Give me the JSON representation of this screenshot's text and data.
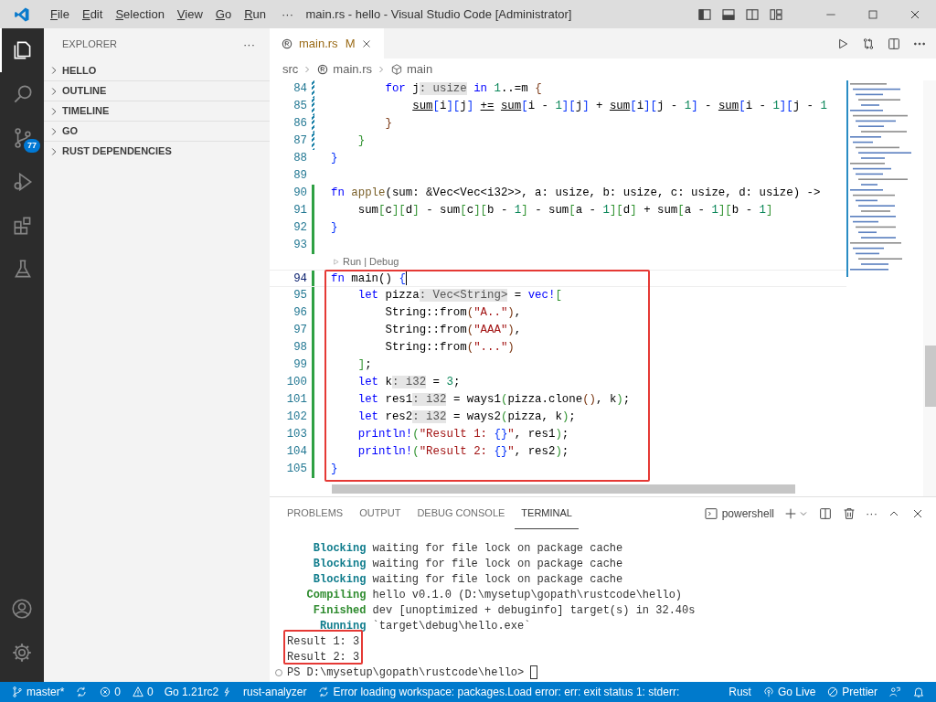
{
  "window": {
    "title": "main.rs - hello - Visual Studio Code [Administrator]"
  },
  "menu": [
    {
      "label": "File"
    },
    {
      "label": "Edit"
    },
    {
      "label": "Selection"
    },
    {
      "label": "View"
    },
    {
      "label": "Go"
    },
    {
      "label": "Run"
    }
  ],
  "menu_more": "···",
  "activity_bar": [
    {
      "kind": "explorer",
      "selected": true
    },
    {
      "kind": "search",
      "selected": false
    },
    {
      "kind": "source-control",
      "selected": false,
      "badge": "77"
    },
    {
      "kind": "run-debug",
      "selected": false
    },
    {
      "kind": "extensions",
      "selected": false
    },
    {
      "kind": "testing",
      "selected": false
    }
  ],
  "activity_bar_bottom": [
    {
      "kind": "account"
    },
    {
      "kind": "settings"
    }
  ],
  "sidebar": {
    "title": "EXPLORER",
    "more": "···",
    "sections": [
      {
        "label": "HELLO",
        "expanded": false
      },
      {
        "label": "OUTLINE",
        "expanded": false
      },
      {
        "label": "TIMELINE",
        "expanded": false
      },
      {
        "label": "GO",
        "expanded": false
      },
      {
        "label": "RUST DEPENDENCIES",
        "expanded": false
      }
    ]
  },
  "tabs": [
    {
      "label": "main.rs",
      "status": "M",
      "selected": true
    }
  ],
  "breadcrumb": [
    {
      "kind": "folder",
      "label": "src"
    },
    {
      "kind": "file",
      "label": "main.rs"
    },
    {
      "kind": "function",
      "label": "main"
    }
  ],
  "editor": {
    "lines": [
      {
        "kind": "code",
        "number": "84",
        "modified": true,
        "added": false,
        "current": false,
        "tokens": [
          {
            "kind": "kw",
            "text": "        for"
          },
          {
            "kind": "p",
            "text": " j"
          },
          {
            "kind": "hint",
            "text": ": usize"
          },
          {
            "kind": "kw",
            "text": " in"
          },
          {
            "kind": "num",
            "text": " 1"
          },
          {
            "kind": "p",
            "text": "..=m "
          },
          {
            "kind": "b3",
            "text": "{"
          }
        ]
      },
      {
        "kind": "code",
        "number": "85",
        "modified": true,
        "added": false,
        "current": false,
        "tokens": [
          {
            "kind": "ul",
            "text": "            sum"
          },
          {
            "kind": "b1",
            "text": "["
          },
          {
            "kind": "p",
            "text": "i"
          },
          {
            "kind": "b1",
            "text": "]["
          },
          {
            "kind": "p",
            "text": "j"
          },
          {
            "kind": "b1",
            "text": "]"
          },
          {
            "kind": "ul",
            "text": " +="
          },
          {
            "kind": "ul",
            "text": " sum"
          },
          {
            "kind": "b1",
            "text": "["
          },
          {
            "kind": "p",
            "text": "i - "
          },
          {
            "kind": "num",
            "text": "1"
          },
          {
            "kind": "b1",
            "text": "]["
          },
          {
            "kind": "p",
            "text": "j"
          },
          {
            "kind": "b1",
            "text": "]"
          },
          {
            "kind": "p",
            "text": " + "
          },
          {
            "kind": "ul",
            "text": "sum"
          },
          {
            "kind": "b1",
            "text": "["
          },
          {
            "kind": "p",
            "text": "i"
          },
          {
            "kind": "b1",
            "text": "]["
          },
          {
            "kind": "p",
            "text": "j - "
          },
          {
            "kind": "num",
            "text": "1"
          },
          {
            "kind": "b1",
            "text": "]"
          },
          {
            "kind": "p",
            "text": " - "
          },
          {
            "kind": "ul",
            "text": "sum"
          },
          {
            "kind": "b1",
            "text": "["
          },
          {
            "kind": "p",
            "text": "i - "
          },
          {
            "kind": "num",
            "text": "1"
          },
          {
            "kind": "b1",
            "text": "]["
          },
          {
            "kind": "p",
            "text": "j - "
          },
          {
            "kind": "num",
            "text": "1"
          }
        ]
      },
      {
        "kind": "code",
        "number": "86",
        "modified": true,
        "added": false,
        "current": false,
        "tokens": [
          {
            "kind": "b3",
            "text": "        }"
          }
        ]
      },
      {
        "kind": "code",
        "number": "87",
        "modified": true,
        "added": false,
        "current": false,
        "tokens": [
          {
            "kind": "b2",
            "text": "    }"
          }
        ]
      },
      {
        "kind": "code",
        "number": "88",
        "modified": false,
        "added": false,
        "current": false,
        "tokens": [
          {
            "kind": "b1",
            "text": "}"
          }
        ]
      },
      {
        "kind": "code",
        "number": "89",
        "modified": false,
        "added": false,
        "current": false
      },
      {
        "kind": "code",
        "number": "90",
        "modified": false,
        "added": true,
        "current": false,
        "tokens": [
          {
            "kind": "kw",
            "text": "fn"
          },
          {
            "kind": "fn",
            "text": " apple"
          },
          {
            "kind": "p",
            "text": "(sum: &Vec<Vec<i32>>, a: usize, b: usize, c: usize, d: usize) ->"
          }
        ]
      },
      {
        "kind": "code",
        "number": "91",
        "modified": false,
        "added": true,
        "current": false,
        "tokens": [
          {
            "kind": "p",
            "text": "    sum"
          },
          {
            "kind": "b2",
            "text": "["
          },
          {
            "kind": "p",
            "text": "c"
          },
          {
            "kind": "b2",
            "text": "]["
          },
          {
            "kind": "p",
            "text": "d"
          },
          {
            "kind": "b2",
            "text": "]"
          },
          {
            "kind": "p",
            "text": " - sum"
          },
          {
            "kind": "b2",
            "text": "["
          },
          {
            "kind": "p",
            "text": "c"
          },
          {
            "kind": "b2",
            "text": "]["
          },
          {
            "kind": "p",
            "text": "b - "
          },
          {
            "kind": "num",
            "text": "1"
          },
          {
            "kind": "b2",
            "text": "]"
          },
          {
            "kind": "p",
            "text": " - sum"
          },
          {
            "kind": "b2",
            "text": "["
          },
          {
            "kind": "p",
            "text": "a - "
          },
          {
            "kind": "num",
            "text": "1"
          },
          {
            "kind": "b2",
            "text": "]["
          },
          {
            "kind": "p",
            "text": "d"
          },
          {
            "kind": "b2",
            "text": "]"
          },
          {
            "kind": "p",
            "text": " + sum"
          },
          {
            "kind": "b2",
            "text": "["
          },
          {
            "kind": "p",
            "text": "a - "
          },
          {
            "kind": "num",
            "text": "1"
          },
          {
            "kind": "b2",
            "text": "]["
          },
          {
            "kind": "p",
            "text": "b - "
          },
          {
            "kind": "num",
            "text": "1"
          },
          {
            "kind": "b2",
            "text": "]"
          }
        ]
      },
      {
        "kind": "code",
        "number": "92",
        "modified": false,
        "added": true,
        "current": false,
        "tokens": [
          {
            "kind": "b1",
            "text": "}"
          }
        ]
      },
      {
        "kind": "code",
        "number": "93",
        "modified": false,
        "added": true,
        "current": false
      },
      {
        "kind": "codelens",
        "links": [
          "Run",
          "Debug"
        ],
        "separator": "|"
      },
      {
        "kind": "code",
        "number": "94",
        "modified": false,
        "added": true,
        "current": true,
        "tokens": [
          {
            "kind": "kw",
            "text": "fn"
          },
          {
            "kind": "p",
            "text": " main() "
          },
          {
            "kind": "b1",
            "text": "{"
          }
        ]
      },
      {
        "kind": "code",
        "number": "95",
        "modified": false,
        "added": true,
        "current": false,
        "tokens": [
          {
            "kind": "kw",
            "text": "    let"
          },
          {
            "kind": "p",
            "text": " pizza"
          },
          {
            "kind": "hint",
            "text": ": Vec<String>"
          },
          {
            "kind": "p",
            "text": " = "
          },
          {
            "kind": "kw",
            "text": "vec!"
          },
          {
            "kind": "b2",
            "text": "["
          }
        ]
      },
      {
        "kind": "code",
        "number": "96",
        "modified": false,
        "added": true,
        "current": false,
        "tokens": [
          {
            "kind": "p",
            "text": "        String::from"
          },
          {
            "kind": "b3",
            "text": "("
          },
          {
            "kind": "str",
            "text": "\"A..\""
          },
          {
            "kind": "b3",
            "text": ")"
          },
          {
            "kind": "p",
            "text": ","
          }
        ]
      },
      {
        "kind": "code",
        "number": "97",
        "modified": false,
        "added": true,
        "current": false,
        "tokens": [
          {
            "kind": "p",
            "text": "        String::from"
          },
          {
            "kind": "b3",
            "text": "("
          },
          {
            "kind": "str",
            "text": "\"AAA\""
          },
          {
            "kind": "b3",
            "text": ")"
          },
          {
            "kind": "p",
            "text": ","
          }
        ]
      },
      {
        "kind": "code",
        "number": "98",
        "modified": false,
        "added": true,
        "current": false,
        "tokens": [
          {
            "kind": "p",
            "text": "        String::from"
          },
          {
            "kind": "b3",
            "text": "("
          },
          {
            "kind": "str",
            "text": "\"...\""
          },
          {
            "kind": "b3",
            "text": ")"
          }
        ]
      },
      {
        "kind": "code",
        "number": "99",
        "modified": false,
        "added": true,
        "current": false,
        "tokens": [
          {
            "kind": "b2",
            "text": "    ]"
          },
          {
            "kind": "p",
            "text": ";"
          }
        ]
      },
      {
        "kind": "code",
        "number": "100",
        "modified": false,
        "added": true,
        "current": false,
        "tokens": [
          {
            "kind": "kw",
            "text": "    let"
          },
          {
            "kind": "p",
            "text": " k"
          },
          {
            "kind": "hint",
            "text": ": i32"
          },
          {
            "kind": "p",
            "text": " = "
          },
          {
            "kind": "num",
            "text": "3"
          },
          {
            "kind": "p",
            "text": ";"
          }
        ]
      },
      {
        "kind": "code",
        "number": "101",
        "modified": false,
        "added": true,
        "current": false,
        "tokens": [
          {
            "kind": "kw",
            "text": "    let"
          },
          {
            "kind": "p",
            "text": " res1"
          },
          {
            "kind": "hint",
            "text": ": i32"
          },
          {
            "kind": "p",
            "text": " = ways1"
          },
          {
            "kind": "b2",
            "text": "("
          },
          {
            "kind": "p",
            "text": "pizza.clone"
          },
          {
            "kind": "b3",
            "text": "()"
          },
          {
            "kind": "p",
            "text": ", k"
          },
          {
            "kind": "b2",
            "text": ")"
          },
          {
            "kind": "p",
            "text": ";"
          }
        ]
      },
      {
        "kind": "code",
        "number": "102",
        "modified": false,
        "added": true,
        "current": false,
        "tokens": [
          {
            "kind": "kw",
            "text": "    let"
          },
          {
            "kind": "p",
            "text": " res2"
          },
          {
            "kind": "hint",
            "text": ": i32"
          },
          {
            "kind": "p",
            "text": " = ways2"
          },
          {
            "kind": "b2",
            "text": "("
          },
          {
            "kind": "p",
            "text": "pizza, k"
          },
          {
            "kind": "b2",
            "text": ")"
          },
          {
            "kind": "p",
            "text": ";"
          }
        ]
      },
      {
        "kind": "code",
        "number": "103",
        "modified": false,
        "added": true,
        "current": false,
        "tokens": [
          {
            "kind": "kw",
            "text": "    println!"
          },
          {
            "kind": "b2",
            "text": "("
          },
          {
            "kind": "str",
            "text": "\"Result 1: "
          },
          {
            "kind": "b1",
            "text": "{}"
          },
          {
            "kind": "str",
            "text": "\""
          },
          {
            "kind": "p",
            "text": ", res1"
          },
          {
            "kind": "b2",
            "text": ")"
          },
          {
            "kind": "p",
            "text": ";"
          }
        ]
      },
      {
        "kind": "code",
        "number": "104",
        "modified": false,
        "added": true,
        "current": false,
        "tokens": [
          {
            "kind": "kw",
            "text": "    println!"
          },
          {
            "kind": "b2",
            "text": "("
          },
          {
            "kind": "str",
            "text": "\"Result 2: "
          },
          {
            "kind": "b1",
            "text": "{}"
          },
          {
            "kind": "str",
            "text": "\""
          },
          {
            "kind": "p",
            "text": ", res2"
          },
          {
            "kind": "b2",
            "text": ")"
          },
          {
            "kind": "p",
            "text": ";"
          }
        ]
      },
      {
        "kind": "code",
        "number": "105",
        "modified": false,
        "added": true,
        "current": false,
        "tokens": [
          {
            "kind": "b1",
            "text": "}"
          }
        ]
      }
    ]
  },
  "panel": {
    "tabs": [
      {
        "label": "PROBLEMS",
        "selected": false
      },
      {
        "label": "OUTPUT",
        "selected": false
      },
      {
        "label": "DEBUG CONSOLE",
        "selected": false
      },
      {
        "label": "TERMINAL",
        "selected": true
      }
    ],
    "shell": "powershell",
    "more": "···",
    "terminal": [
      {
        "kind": "cargo",
        "label": "Blocking",
        "color": "#0f7c8c",
        "text": "waiting for file lock on package cache"
      },
      {
        "kind": "cargo",
        "label": "Blocking",
        "color": "#0f7c8c",
        "text": "waiting for file lock on package cache"
      },
      {
        "kind": "cargo",
        "label": "Blocking",
        "color": "#0f7c8c",
        "text": "waiting for file lock on package cache"
      },
      {
        "kind": "cargo",
        "label": "Compiling",
        "color": "#2e8b2e",
        "text": "hello v0.1.0 (D:\\mysetup\\gopath\\rustcode\\hello)"
      },
      {
        "kind": "cargo",
        "label": "Finished",
        "color": "#2e8b2e",
        "text": "dev [unoptimized + debuginfo] target(s) in 32.40s"
      },
      {
        "kind": "cargo",
        "label": "Running",
        "color": "#0f7c8c",
        "text": "`target\\debug\\hello.exe`"
      },
      {
        "kind": "output",
        "text": "Result 1: 3"
      },
      {
        "kind": "output",
        "text": "Result 2: 3"
      },
      {
        "kind": "prompt",
        "text": "PS D:\\mysetup\\gopath\\rustcode\\hello>"
      }
    ]
  },
  "status_bar": {
    "left": [
      {
        "kind": "branch",
        "text": "master*"
      },
      {
        "kind": "sync"
      },
      {
        "kind": "errors",
        "text": "0"
      },
      {
        "kind": "warnings",
        "text": "0"
      },
      {
        "kind": "go-version",
        "text": "Go 1.21rc2"
      },
      {
        "kind": "plain",
        "text": "rust-analyzer"
      },
      {
        "kind": "sync",
        "text": "Error loading workspace: packages.Load error: err: exit status 1: stderr:"
      }
    ],
    "right": [
      {
        "kind": "plain",
        "text": "Rust"
      },
      {
        "kind": "live",
        "text": "Go Live"
      },
      {
        "kind": "prettier",
        "text": "Prettier"
      },
      {
        "kind": "feedback"
      },
      {
        "kind": "notifications"
      }
    ]
  }
}
